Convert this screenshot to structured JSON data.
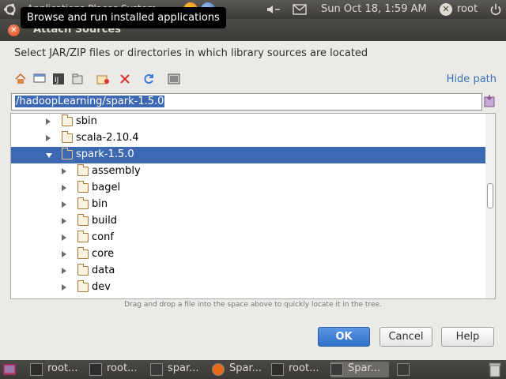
{
  "top_panel": {
    "apps_menu": "Applications  Places  System",
    "clock": "Sun Oct 18,  1:59 AM",
    "user": "root"
  },
  "tooltip": "Browse and run installed applications",
  "dialog": {
    "title": "Attach Sources",
    "description": "Select JAR/ZIP files or directories in which library sources are located",
    "hide_path": "Hide path",
    "path_value": "/hadoopLearning/spark-1.5.0",
    "tree": [
      {
        "label": "sbin",
        "expanded": false,
        "selected": false
      },
      {
        "label": "scala-2.10.4",
        "expanded": false,
        "selected": false
      },
      {
        "label": "spark-1.5.0",
        "expanded": true,
        "selected": true
      },
      {
        "label": "assembly",
        "expanded": false,
        "selected": false
      },
      {
        "label": "bagel",
        "expanded": false,
        "selected": false
      },
      {
        "label": "bin",
        "expanded": false,
        "selected": false
      },
      {
        "label": "build",
        "expanded": false,
        "selected": false
      },
      {
        "label": "conf",
        "expanded": false,
        "selected": false
      },
      {
        "label": "core",
        "expanded": false,
        "selected": false
      },
      {
        "label": "data",
        "expanded": false,
        "selected": false
      },
      {
        "label": "dev",
        "expanded": false,
        "selected": false
      }
    ],
    "hint": "Drag and drop a file into the space above to quickly locate it in the tree.",
    "ok_label": "OK",
    "cancel_label": "Cancel",
    "help_label": "Help",
    "accent_color": "#3d69b3"
  },
  "taskbar": {
    "tasks": [
      {
        "label": "root...",
        "icon": "terminal-icon"
      },
      {
        "label": "root...",
        "icon": "terminal-icon"
      },
      {
        "label": "spar...",
        "icon": "intellij-icon"
      },
      {
        "label": "Spar...",
        "icon": "firefox-icon"
      },
      {
        "label": "root...",
        "icon": "terminal-icon"
      },
      {
        "label": "Spar...",
        "icon": "intellij-icon"
      }
    ]
  }
}
